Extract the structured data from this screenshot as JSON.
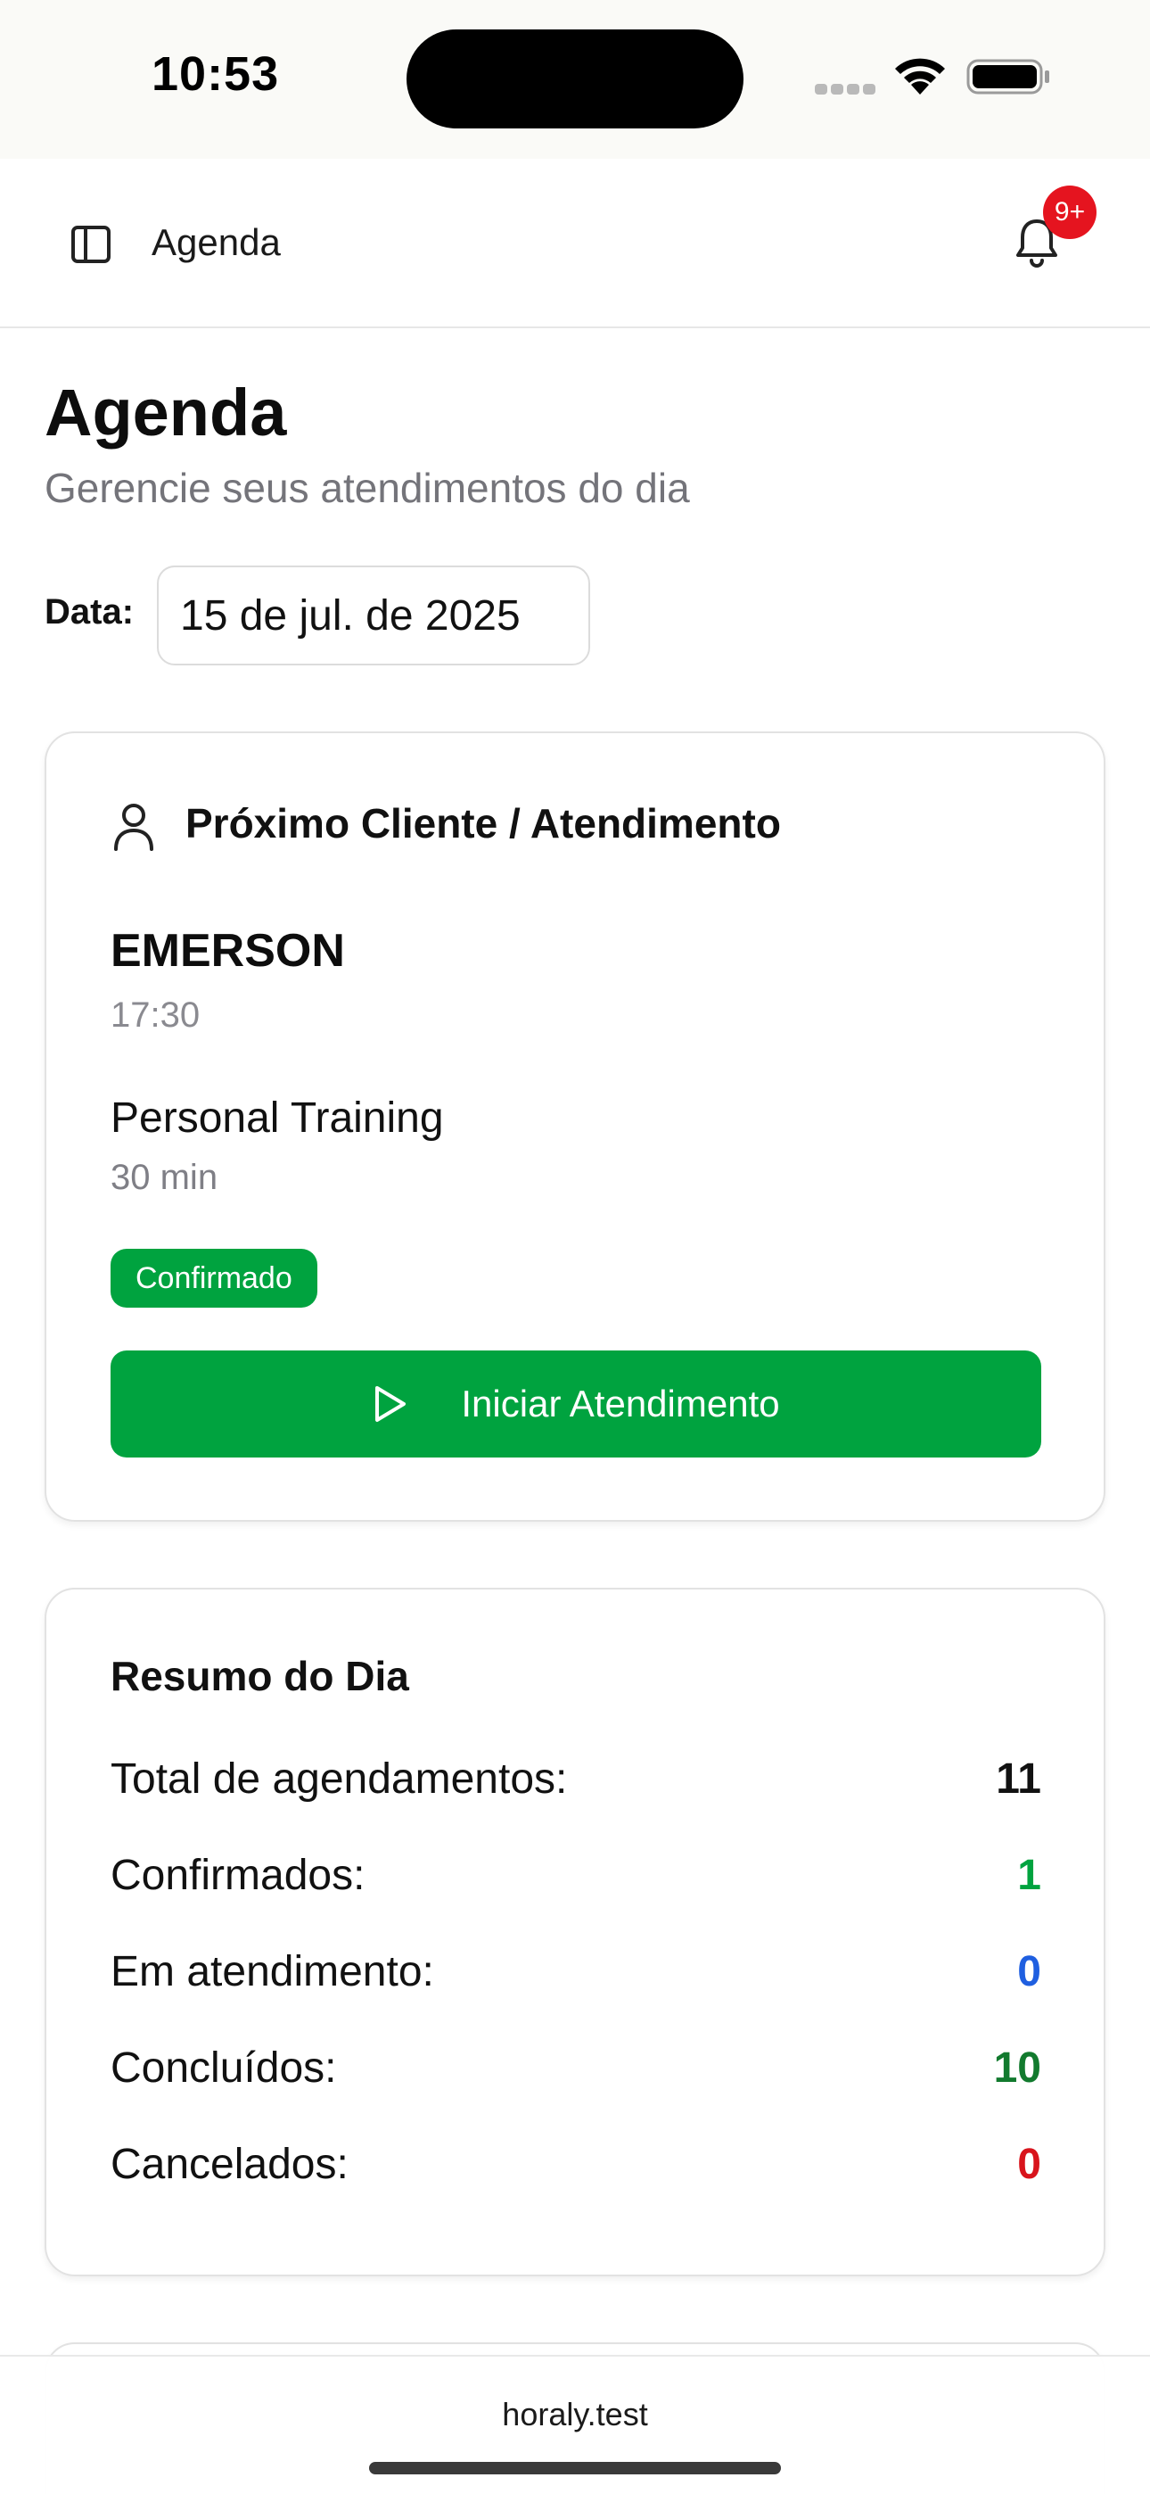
{
  "status_bar": {
    "time": "10:53"
  },
  "header": {
    "title": "Agenda",
    "notification_badge": "9+"
  },
  "page": {
    "title": "Agenda",
    "subtitle": "Gerencie seus atendimentos do dia",
    "date_label": "Data:",
    "date_value": "15 de jul. de 2025"
  },
  "next_client": {
    "heading": "Próximo Cliente / Atendimento",
    "name": "EMERSON",
    "time": "17:30",
    "service": "Personal Training",
    "duration": "30 min",
    "status": "Confirmado",
    "start_button": "Iniciar Atendimento",
    "accent_color": "#00a33f"
  },
  "summary": {
    "title": "Resumo do Dia",
    "rows": [
      {
        "label": "Total de agendamentos:",
        "value": "11",
        "color": "#111111"
      },
      {
        "label": "Confirmados:",
        "value": "1",
        "color": "#00a33f"
      },
      {
        "label": "Em atendimento:",
        "value": "0",
        "color": "#1f5fe0"
      },
      {
        "label": "Concluídos:",
        "value": "10",
        "color": "#127a2e"
      },
      {
        "label": "Cancelados:",
        "value": "0",
        "color": "#d8141c"
      }
    ]
  },
  "browser": {
    "url": "horaly.test"
  }
}
